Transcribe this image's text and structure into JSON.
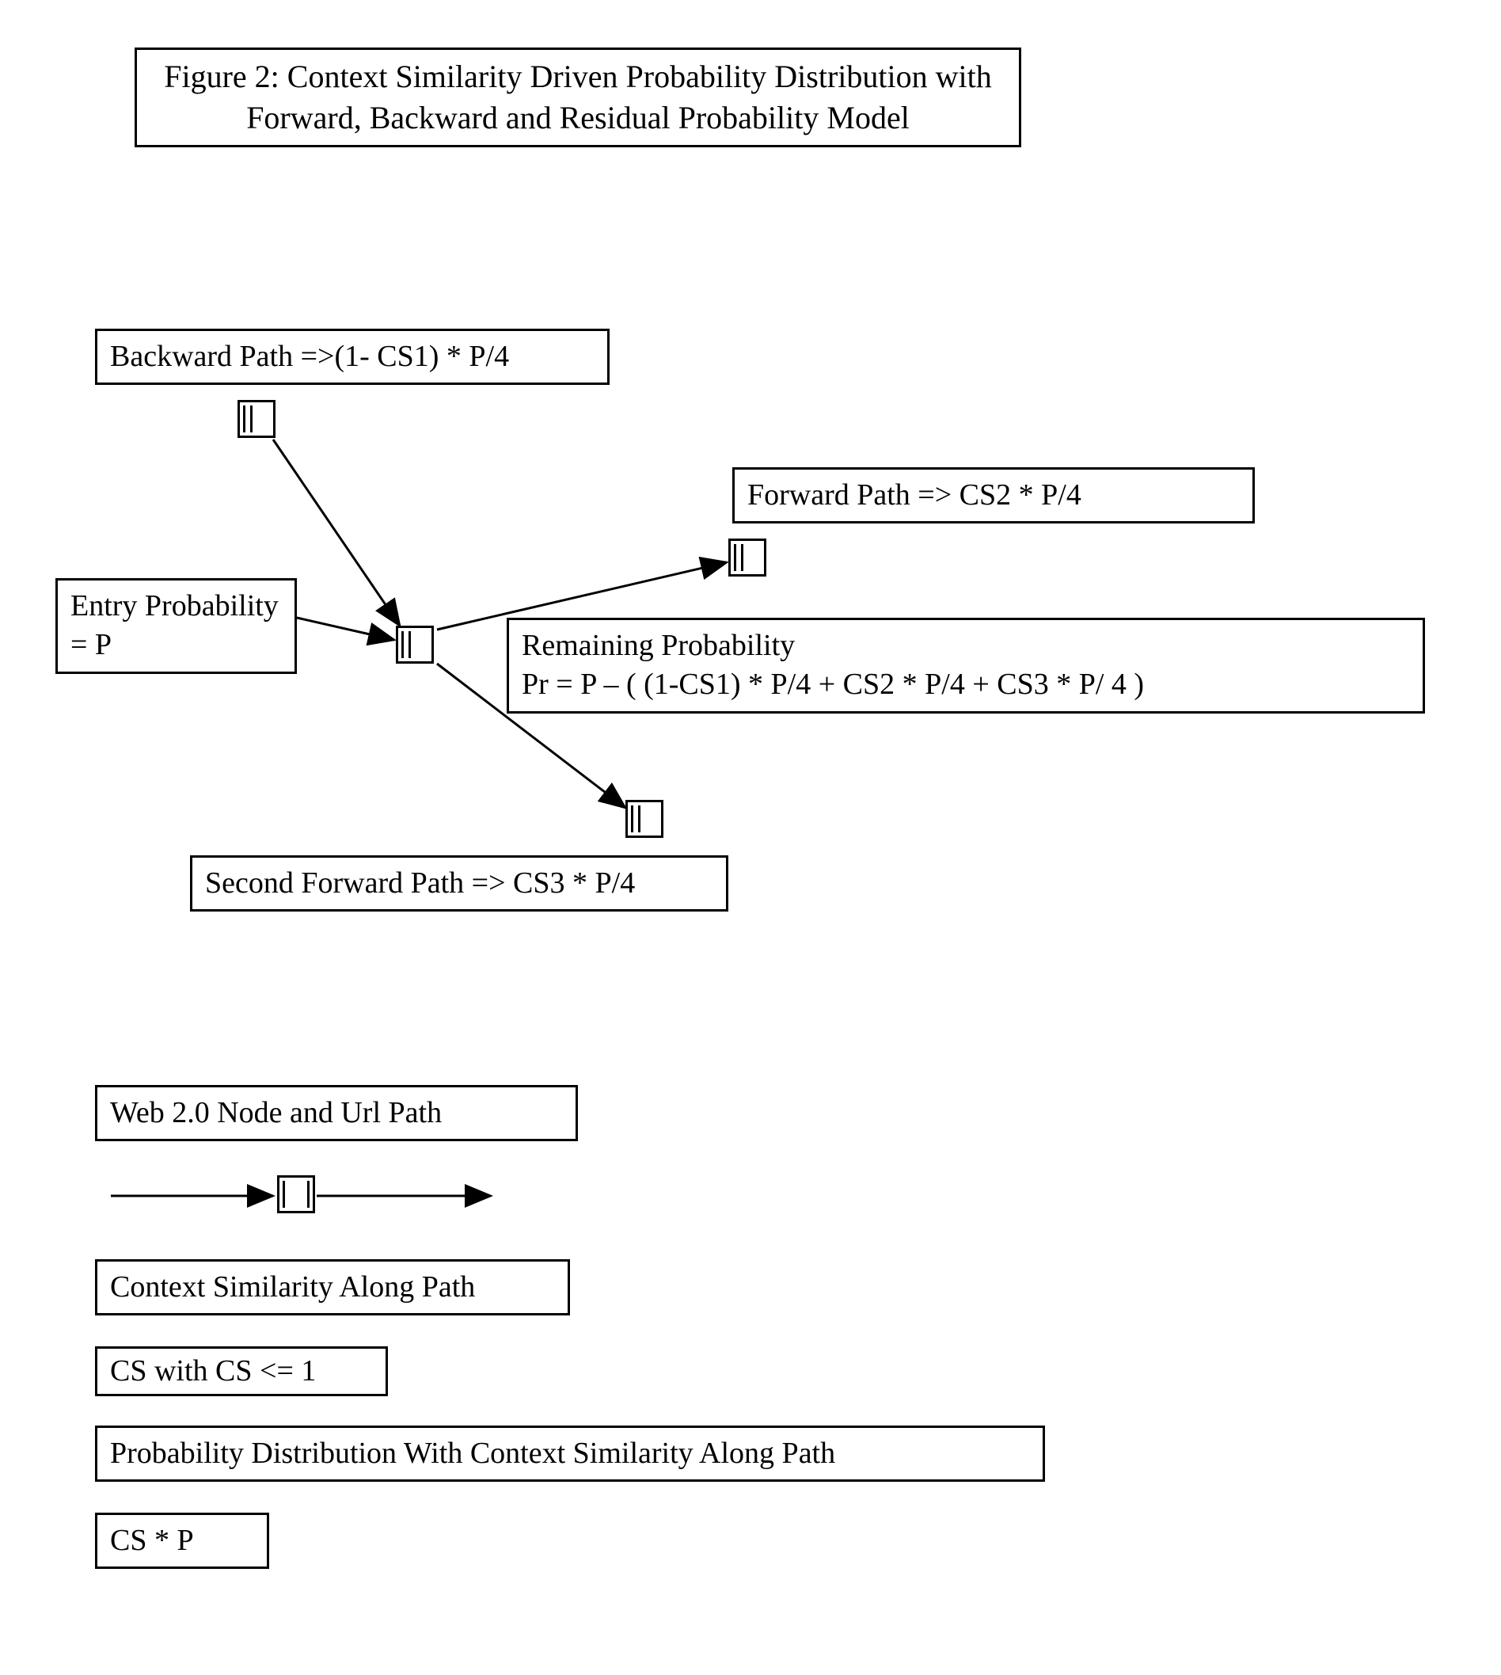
{
  "title": {
    "line1": "Figure 2:  Context Similarity Driven Probability Distribution with",
    "line2": "Forward, Backward and Residual Probability Model"
  },
  "diagram": {
    "backward_path": "Backward Path =>(1- CS1)  *   P/4",
    "entry_probability": "Entry Probability = P",
    "forward_path": "Forward Path => CS2 * P/4",
    "remaining_line1": "Remaining Probability",
    "remaining_line2": "Pr = P – ( (1-CS1) * P/4 + CS2 * P/4 + CS3 * P/ 4 )",
    "second_forward": "Second Forward Path => CS3 * P/4"
  },
  "legend": {
    "web_node": "Web 2.0 Node and Url Path",
    "context_sim": "Context Similarity Along Path",
    "cs_constraint": "CS with  CS <= 1",
    "prob_dist": "Probability Distribution With Context Similarity Along Path",
    "cs_p": "CS * P"
  }
}
